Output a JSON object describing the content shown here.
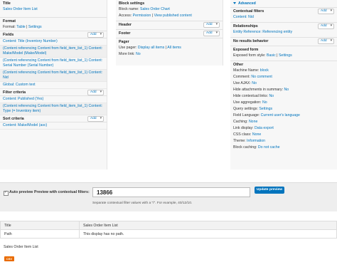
{
  "col1": {
    "title_label": "Title",
    "title_value": "Sales Order Item List",
    "format_label": "Format",
    "format_prefix": "Format:",
    "format_value": "Table",
    "format_sep": "|",
    "format_settings": "Settings",
    "fields_label": "Fields",
    "add_label": "Add",
    "fields": [
      "Content: Title (Inventory Number)",
      "(Content referencing Content from field_item_list_1) Content: Make/Model (Make/Model)",
      "(Content referencing Content from field_item_list_1) Content: Serial Number (Serial Number)",
      "(Content referencing Content from field_item_list_1) Content: Nid",
      "Global: Custom text"
    ],
    "filter_label": "Filter criteria",
    "filters": [
      "Content: Published (Yes)",
      "(Content referencing Content from field_item_list_1) Content: Type (= Inventory item)"
    ],
    "sort_label": "Sort criteria",
    "sorts": [
      "Content: Make/Model (asc)"
    ]
  },
  "col2": {
    "block_settings_label": "Block settings",
    "block_name_prefix": "Block name:",
    "block_name_value": "Sales Order Chart",
    "access_prefix": "Access:",
    "access_value": "Permission",
    "access_sep": "|",
    "access_view": "View published content",
    "header_label": "Header",
    "footer_label": "Footer",
    "pager_label": "Pager",
    "use_pager_prefix": "Use pager:",
    "use_pager_value": "Display all items",
    "use_pager_sep": "|",
    "use_pager_all": "All items",
    "more_link_prefix": "More link:",
    "more_link_value": "No",
    "add_label": "Add"
  },
  "col3": {
    "advanced_label": "Advanced",
    "contextual_label": "Contextual filters",
    "contextual_item": "Content: Nid",
    "relationships_label": "Relationships",
    "relationship_item": "Entity Reference: Referencing entity",
    "no_results_label": "No results behavior",
    "exposed_label": "Exposed form",
    "exposed_style_prefix": "Exposed form style:",
    "exposed_style_value": "Basic",
    "exposed_sep": "|",
    "exposed_settings": "Settings",
    "other_label": "Other",
    "add_label": "Add",
    "other_rows": [
      {
        "k": "Machine Name:",
        "v": "block"
      },
      {
        "k": "Comment:",
        "v": "No comment"
      },
      {
        "k": "Use AJAX:",
        "v": "No"
      },
      {
        "k": "Hide attachments in summary:",
        "v": "No"
      },
      {
        "k": "Hide contextual links:",
        "v": "No"
      },
      {
        "k": "Use aggregation:",
        "v": "No"
      },
      {
        "k": "Query settings:",
        "v": "Settings"
      },
      {
        "k": "Field Language:",
        "v": "Current user's language"
      },
      {
        "k": "Caching:",
        "v": "None"
      },
      {
        "k": "Link display:",
        "v": "Data export"
      },
      {
        "k": "CSS class:",
        "v": "None"
      },
      {
        "k": "Theme:",
        "v": "Information"
      },
      {
        "k": "Block caching:",
        "v": "Do not cache"
      }
    ]
  },
  "preview": {
    "auto_label": "Auto preview",
    "contextual_label": "Preview with contextual filters:",
    "input_value": "13866",
    "description": "Separate contextual filter values with a \"/\". For example, 40/12/10.",
    "button_label": "Update preview"
  },
  "preview_table": {
    "rows": [
      {
        "k": "Title",
        "v": "Sales Order Item List"
      },
      {
        "k": "Path",
        "v": "This display has no path."
      }
    ]
  },
  "view_title": "Sales Order Item List",
  "csv_label": "CSV",
  "colors": {
    "link": "#0074bd",
    "csv": "#e96b00",
    "panel": "#f7f7f7"
  }
}
